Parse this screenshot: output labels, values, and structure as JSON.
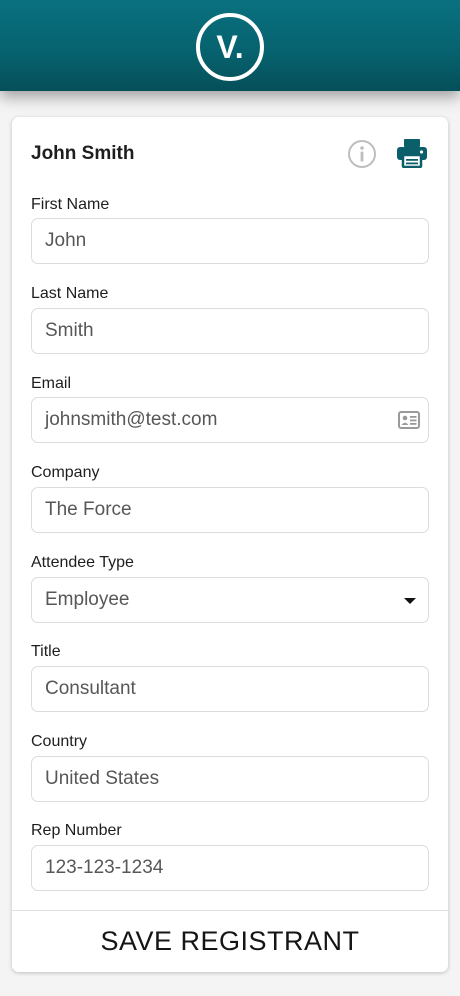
{
  "header": {
    "logo_text": "V."
  },
  "card": {
    "title": "John Smith",
    "icons": {
      "info": "info-icon",
      "print": "printer-icon"
    }
  },
  "form": {
    "first_name": {
      "label": "First Name",
      "value": "John"
    },
    "last_name": {
      "label": "Last Name",
      "value": "Smith"
    },
    "email": {
      "label": "Email",
      "value": "johnsmith@test.com",
      "icon": "contact-card-icon"
    },
    "company": {
      "label": "Company",
      "value": "The Force"
    },
    "attendee_type": {
      "label": "Attendee Type",
      "value": "Employee",
      "icon": "caret-down-icon"
    },
    "title": {
      "label": "Title",
      "value": "Consultant"
    },
    "country": {
      "label": "Country",
      "value": "United States"
    },
    "rep_number": {
      "label": "Rep Number",
      "value": "123-123-1234"
    }
  },
  "actions": {
    "save_label": "SAVE REGISTRANT"
  },
  "colors": {
    "brand": "#06616d",
    "accent_icon": "#0b5f6b",
    "background": "#f4f4f5"
  }
}
